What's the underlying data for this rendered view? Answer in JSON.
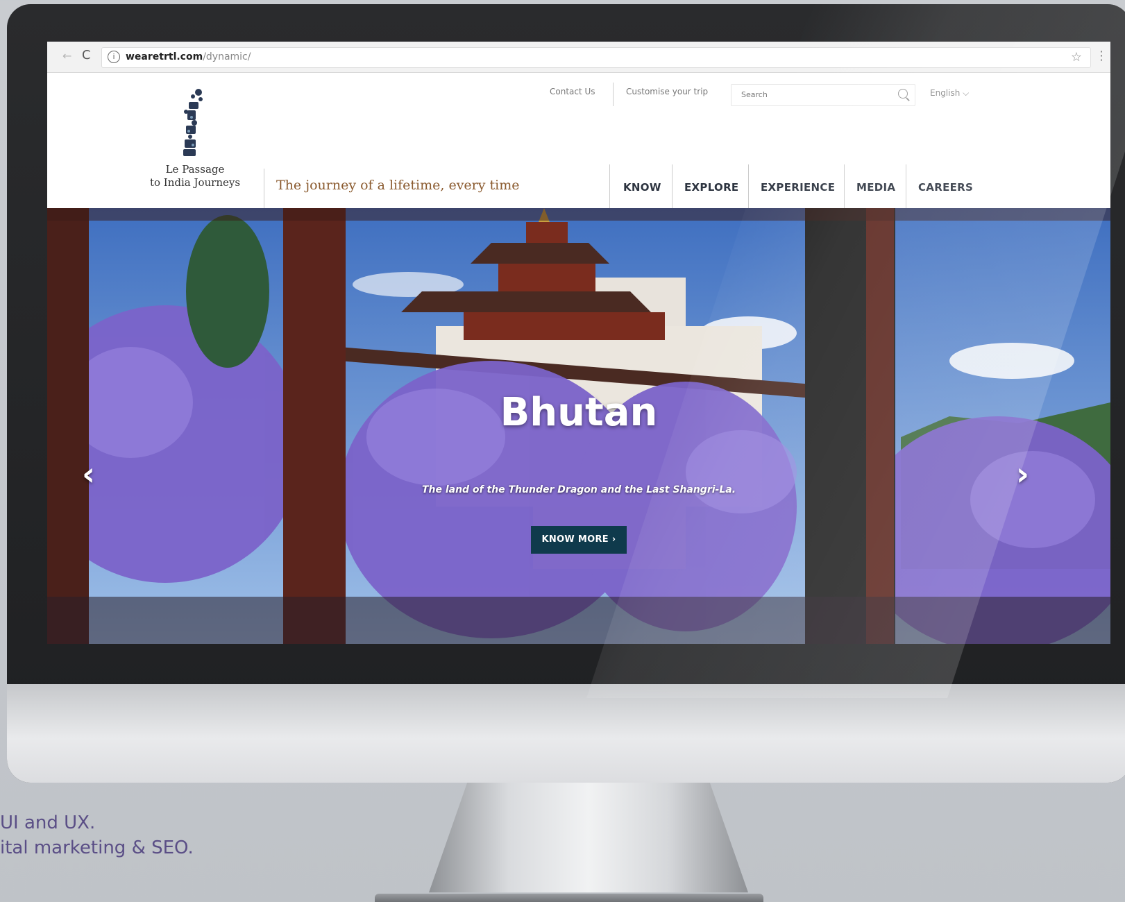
{
  "browser": {
    "url_domain": "wearetrtl.com",
    "url_path": "/dynamic/",
    "back_glyph": "←",
    "reload_glyph": "C",
    "info_glyph": "i",
    "star_glyph": "☆",
    "menu_glyph": "⋮"
  },
  "header": {
    "brand_line1": "Le Passage",
    "brand_line2": "to India Journeys",
    "tagline": "The journey of a lifetime, every time",
    "contact_label": "Contact Us",
    "customise_label": "Customise your trip",
    "search_placeholder": "Search",
    "language_label": "English ⌵",
    "accent_color": "#8a5a2e"
  },
  "nav": {
    "items": [
      {
        "label": "KNOW"
      },
      {
        "label": "EXPLORE"
      },
      {
        "label": "EXPERIENCE"
      },
      {
        "label": "MEDIA"
      },
      {
        "label": "CAREERS"
      }
    ]
  },
  "hero": {
    "title": "Bhutan",
    "subtitle": "The land of the Thunder Dragon and the Last Shangri-La.",
    "cta_label": "KNOW MORE ›",
    "prev_glyph": "‹",
    "next_glyph": "›",
    "cta_color": "#0f3a4c"
  },
  "caption": {
    "line1": "UI and UX.",
    "line2": "ital marketing & SEO."
  }
}
